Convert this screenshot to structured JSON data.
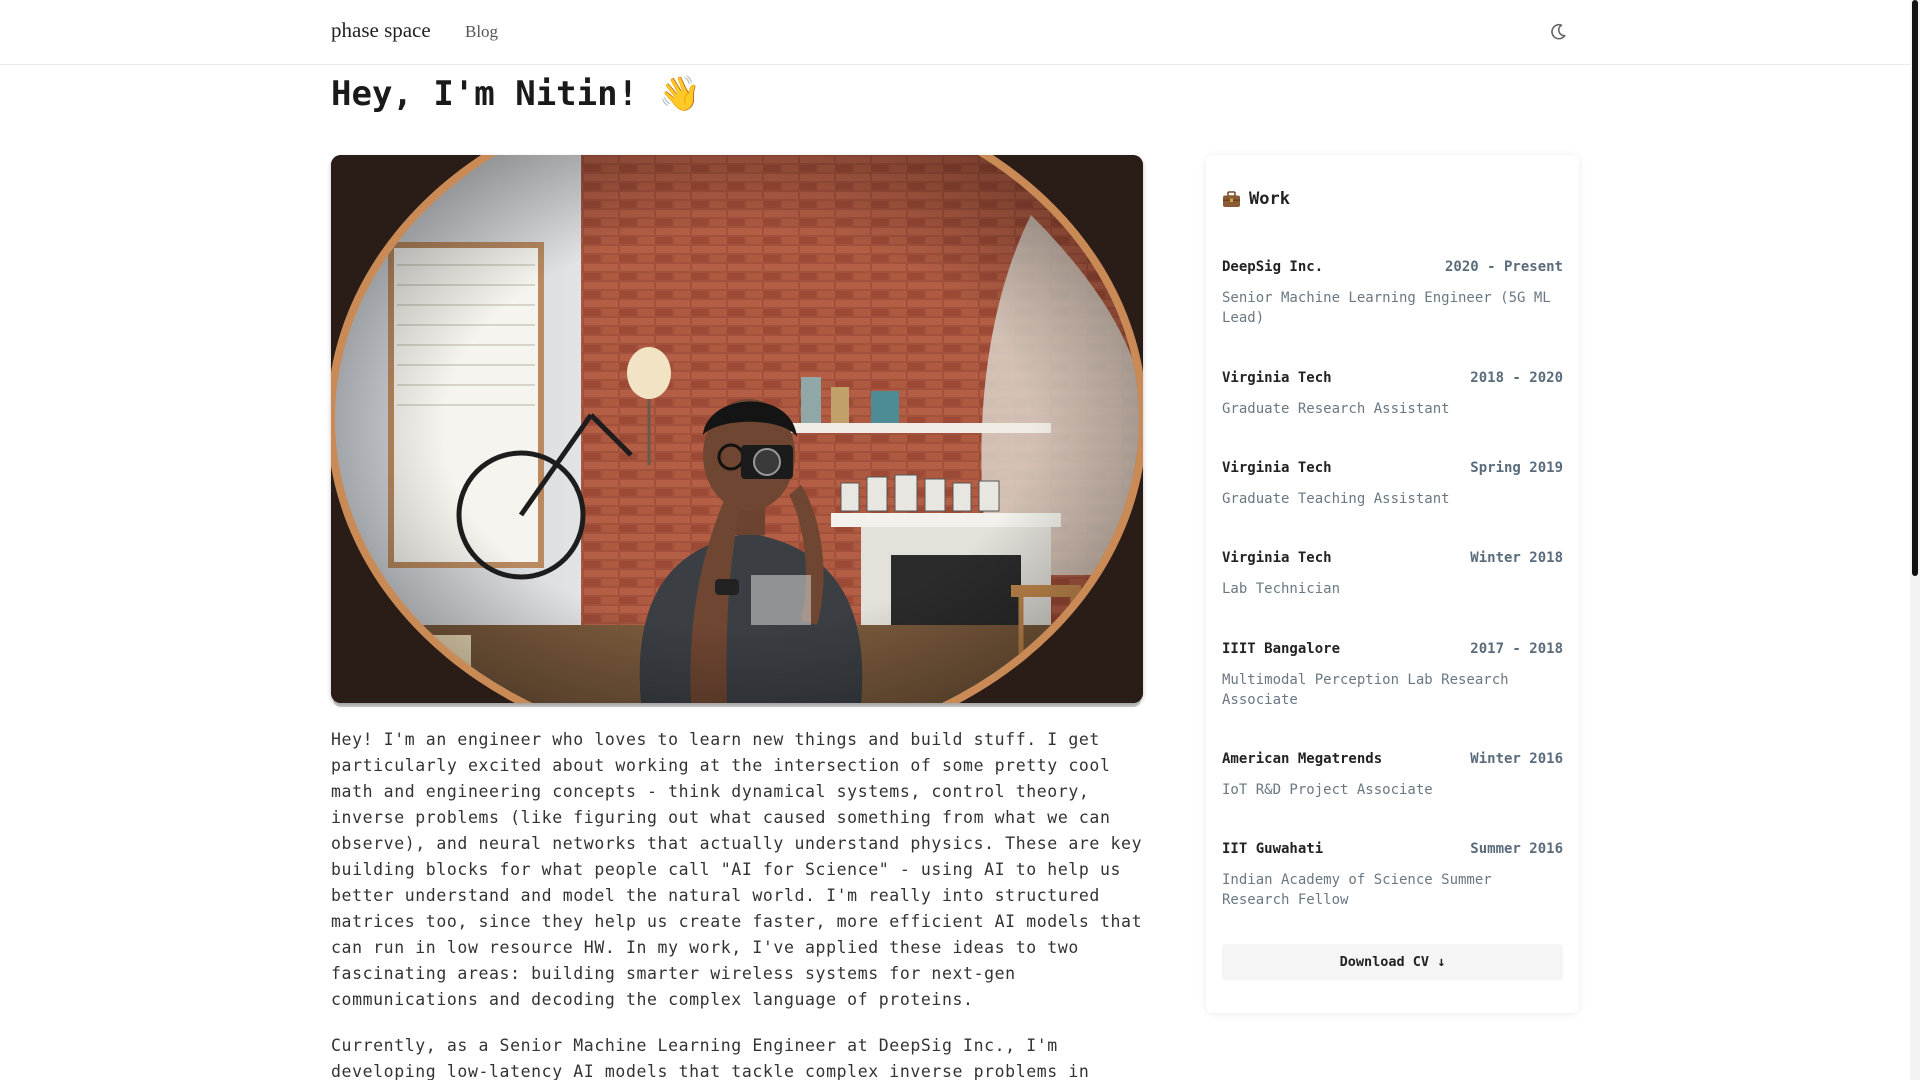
{
  "header": {
    "brand": "phase space",
    "nav": [
      {
        "label": "Blog"
      }
    ],
    "theme_icon": "moon-icon"
  },
  "main": {
    "title": "Hey, I'm Nitin! 👋",
    "photo_icon": "mirror-selfie-photo",
    "bio": [
      "Hey! I'm an engineer who loves to learn new things and build stuff. I get particularly excited about working at the intersection of some pretty cool math and engineering concepts - think dynamical systems, control theory, inverse problems (like figuring out what caused something from what we can observe), and neural networks that actually understand physics. These are key building blocks for what people call \"AI for Science\" - using AI to help us better understand and model the natural world. I'm really into structured matrices too, since they help us create faster, more efficient AI models that can run in low resource HW. In my work, I've applied these ideas to two fascinating areas: building smarter wireless systems for next-gen communications and decoding the complex language of proteins.",
      "Currently, as a Senior Machine Learning Engineer at DeepSig Inc., I'm developing low-latency AI models that tackle complex inverse problems in"
    ]
  },
  "work": {
    "heading": "Work",
    "heading_icon": "briefcase-icon",
    "jobs": [
      {
        "org": "DeepSig Inc.",
        "date": "2020 - Present",
        "role": "Senior Machine Learning Engineer (5G ML Lead)"
      },
      {
        "org": "Virginia Tech",
        "date": "2018 - 2020",
        "role": "Graduate Research Assistant"
      },
      {
        "org": "Virginia Tech",
        "date": "Spring 2019",
        "role": "Graduate Teaching Assistant"
      },
      {
        "org": "Virginia Tech",
        "date": "Winter 2018",
        "role": "Lab Technician"
      },
      {
        "org": "IIIT Bangalore",
        "date": "2017 - 2018",
        "role": "Multimodal Perception Lab Research Associate"
      },
      {
        "org": "American Megatrends",
        "date": "Winter 2016",
        "role": "IoT R&D Project Associate"
      },
      {
        "org": "IIT Guwahati",
        "date": "Summer 2016",
        "role": "Indian Academy of Science Summer Research Fellow"
      }
    ],
    "cv_label": "Download CV ↓"
  },
  "colors": {
    "accent_text": "#222222",
    "muted_text": "#6a7884",
    "date_text": "#5a6b7b",
    "button_bg": "#f5f5f5"
  }
}
